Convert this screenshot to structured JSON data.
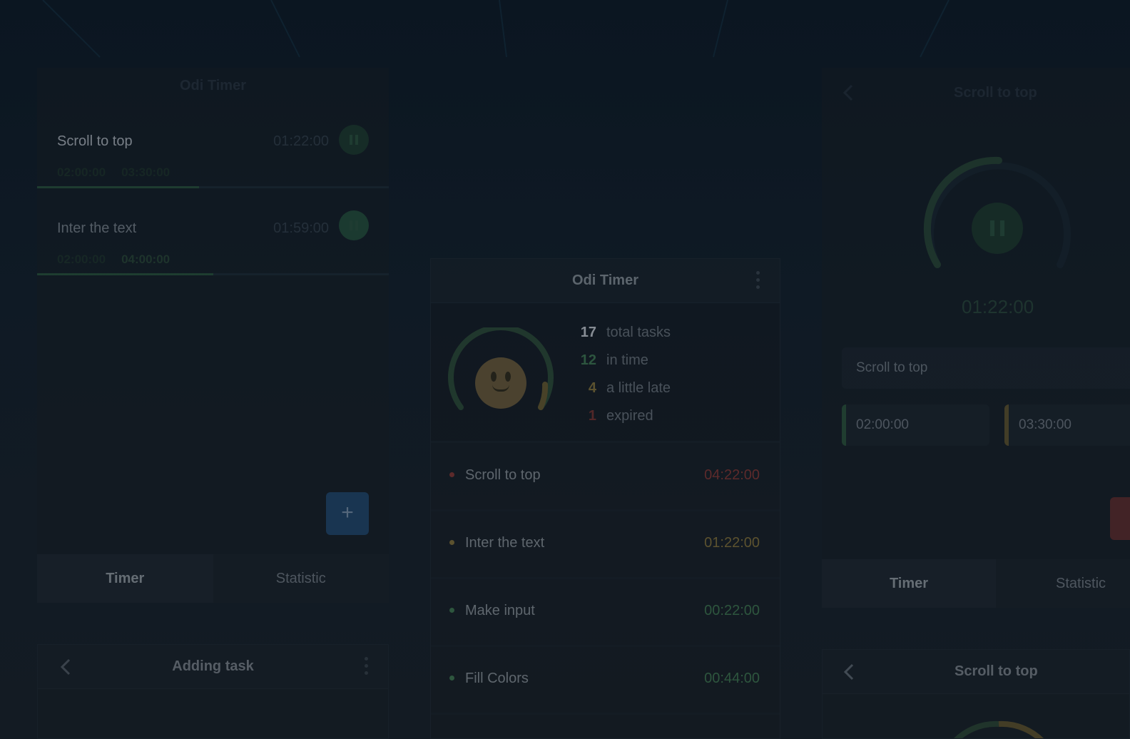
{
  "left_panel": {
    "title": "Odi Timer",
    "tasks": [
      {
        "name": "Scroll to top",
        "elapsed": "01:22:00",
        "start": "02:00:00",
        "end": "03:30:00",
        "progress": 0.46
      },
      {
        "name": "Inter the text",
        "elapsed": "01:59:00",
        "start": "02:00:00",
        "end": "04:00:00",
        "progress": 0.5
      }
    ],
    "add_label": "+",
    "tabs": [
      {
        "label": "Timer"
      },
      {
        "label": "Statistic"
      }
    ]
  },
  "adding_panel": {
    "title": "Adding task"
  },
  "center_panel": {
    "title": "Odi Timer",
    "stats": [
      {
        "count": "17",
        "label": "total tasks",
        "color": "#8d949b"
      },
      {
        "count": "12",
        "label": "in time",
        "color": "#3f7a4f"
      },
      {
        "count": "4",
        "label": "a little late",
        "color": "#8a7436"
      },
      {
        "count": "1",
        "label": "expired",
        "color": "#7a2f2c"
      }
    ],
    "list": [
      {
        "name": "Scroll to top",
        "time": "04:22:00",
        "color": "#8a3430"
      },
      {
        "name": "Inter the text",
        "time": "01:22:00",
        "color": "#8a7436"
      },
      {
        "name": "Make input",
        "time": "00:22:00",
        "color": "#3f7a4f"
      },
      {
        "name": "Fill Colors",
        "time": "00:44:00",
        "color": "#3f7a4f"
      }
    ]
  },
  "right_panel": {
    "title": "Scroll to top",
    "time": "01:22:00",
    "task_field": "Scroll to top",
    "start_field": "02:00:00",
    "end_field": "03:30:00",
    "tabs": [
      {
        "label": "Timer"
      },
      {
        "label": "Statistic"
      }
    ]
  },
  "scroll_panel": {
    "title": "Scroll to top"
  },
  "colors": {
    "accent_green": "#3f7a4f",
    "accent_yellow": "#8a7436",
    "accent_red": "#8a3430",
    "accent_blue": "#1f4c76"
  }
}
